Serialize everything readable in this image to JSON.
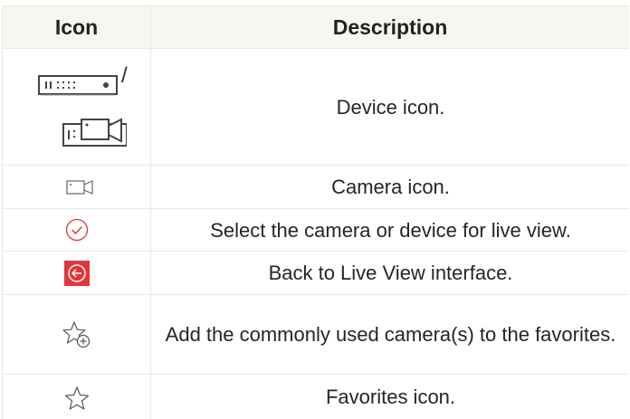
{
  "table": {
    "headers": {
      "icon": "Icon",
      "description": "Description"
    },
    "rows": [
      {
        "icons": [
          "nvr-device-icon",
          "camera-device-icon"
        ],
        "separator": "/",
        "description": "Device icon."
      },
      {
        "icons": [
          "camera-icon"
        ],
        "description": "Camera icon."
      },
      {
        "icons": [
          "select-check-icon"
        ],
        "description": "Select the camera or device for live view."
      },
      {
        "icons": [
          "back-arrow-icon"
        ],
        "description": "Back to Live View interface."
      },
      {
        "icons": [
          "add-favorite-icon"
        ],
        "description": "Add the commonly used camera(s) to the favorites."
      },
      {
        "icons": [
          "favorite-star-icon"
        ],
        "description": "Favorites icon."
      }
    ]
  },
  "colors": {
    "accent_red": "#e0373c",
    "header_bg": "#f4f8f1",
    "icon_gray": "#555555"
  }
}
